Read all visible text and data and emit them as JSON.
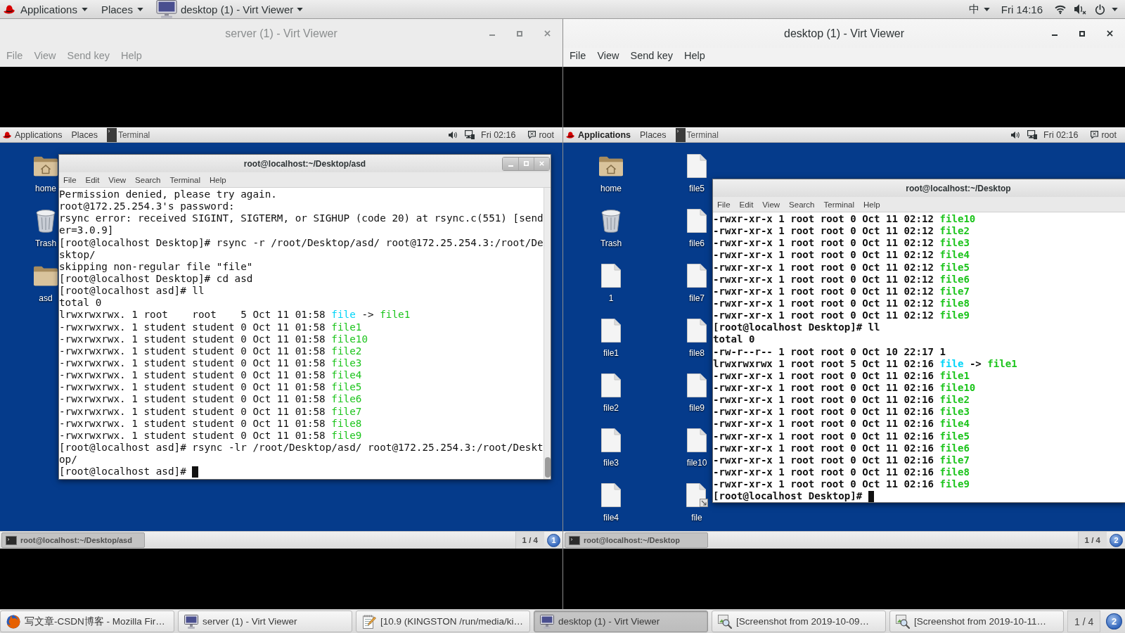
{
  "top_bar": {
    "menus": [
      {
        "label": "Applications"
      },
      {
        "label": "Places"
      }
    ],
    "window_menu": "desktop (1) - Virt Viewer",
    "input_method": "中",
    "clock": "Fri 14:16"
  },
  "windows": [
    {
      "title": "server (1) - Virt Viewer",
      "focused": false,
      "menu": [
        {
          "label": "File"
        },
        {
          "label": "View"
        },
        {
          "label": "Send key"
        },
        {
          "label": "Help"
        }
      ],
      "guest": {
        "top_bar": {
          "menus": [
            {
              "label": "Applications",
              "highlighted": false
            },
            {
              "label": "Places",
              "highlighted": false
            }
          ],
          "app": "Terminal",
          "clock": "Fri 02:16",
          "user": "root"
        },
        "desktop_icons": [
          {
            "label": "home",
            "kind": "home"
          },
          {
            "label": "Trash",
            "kind": "trash"
          },
          {
            "label": "asd",
            "kind": "folder"
          }
        ],
        "terminal": {
          "title": "root@localhost:~/Desktop/asd",
          "window_buttons": true,
          "scrollbar": true,
          "cursor": true,
          "menu": [
            {
              "label": "File"
            },
            {
              "label": "Edit"
            },
            {
              "label": "View"
            },
            {
              "label": "Search"
            },
            {
              "label": "Terminal"
            },
            {
              "label": "Help"
            }
          ],
          "lines": [
            {
              "parts": [
                {
                  "text": "Permission denied, please try again.",
                  "kind": "plain"
                }
              ]
            },
            {
              "parts": [
                {
                  "text": "root@172.25.254.3's password:",
                  "kind": "plain"
                }
              ]
            },
            {
              "parts": [
                {
                  "text": "rsync error: received SIGINT, SIGTERM, or SIGHUP (code 20) at rsync.c(551) [send",
                  "kind": "plain"
                }
              ]
            },
            {
              "parts": [
                {
                  "text": "er=3.0.9]",
                  "kind": "plain"
                }
              ]
            },
            {
              "parts": [
                {
                  "text": "[root@localhost Desktop]# rsync -r /root/Desktop/asd/ root@172.25.254.3:/root/De",
                  "kind": "plain"
                }
              ]
            },
            {
              "parts": [
                {
                  "text": "sktop/",
                  "kind": "plain"
                }
              ]
            },
            {
              "parts": [
                {
                  "text": "skipping non-regular file \"file\"",
                  "kind": "plain"
                }
              ]
            },
            {
              "parts": [
                {
                  "text": "[root@localhost Desktop]# cd asd",
                  "kind": "plain"
                }
              ]
            },
            {
              "parts": [
                {
                  "text": "[root@localhost asd]# ll",
                  "kind": "plain"
                }
              ]
            },
            {
              "parts": [
                {
                  "text": "total 0",
                  "kind": "plain"
                }
              ]
            },
            {
              "parts": [
                {
                  "text": "lrwxrwxrwx. 1 root    root    5 Oct 11 01:58 ",
                  "kind": "plain"
                },
                {
                  "text": "file",
                  "kind": "link"
                },
                {
                  "text": " -> ",
                  "kind": "plain"
                },
                {
                  "text": "file1",
                  "kind": "exec"
                }
              ]
            },
            {
              "parts": [
                {
                  "text": "-rwxrwxrwx. 1 student student 0 Oct 11 01:58 ",
                  "kind": "plain"
                },
                {
                  "text": "file1",
                  "kind": "exec"
                }
              ]
            },
            {
              "parts": [
                {
                  "text": "-rwxrwxrwx. 1 student student 0 Oct 11 01:58 ",
                  "kind": "plain"
                },
                {
                  "text": "file10",
                  "kind": "exec"
                }
              ]
            },
            {
              "parts": [
                {
                  "text": "-rwxrwxrwx. 1 student student 0 Oct 11 01:58 ",
                  "kind": "plain"
                },
                {
                  "text": "file2",
                  "kind": "exec"
                }
              ]
            },
            {
              "parts": [
                {
                  "text": "-rwxrwxrwx. 1 student student 0 Oct 11 01:58 ",
                  "kind": "plain"
                },
                {
                  "text": "file3",
                  "kind": "exec"
                }
              ]
            },
            {
              "parts": [
                {
                  "text": "-rwxrwxrwx. 1 student student 0 Oct 11 01:58 ",
                  "kind": "plain"
                },
                {
                  "text": "file4",
                  "kind": "exec"
                }
              ]
            },
            {
              "parts": [
                {
                  "text": "-rwxrwxrwx. 1 student student 0 Oct 11 01:58 ",
                  "kind": "plain"
                },
                {
                  "text": "file5",
                  "kind": "exec"
                }
              ]
            },
            {
              "parts": [
                {
                  "text": "-rwxrwxrwx. 1 student student 0 Oct 11 01:58 ",
                  "kind": "plain"
                },
                {
                  "text": "file6",
                  "kind": "exec"
                }
              ]
            },
            {
              "parts": [
                {
                  "text": "-rwxrwxrwx. 1 student student 0 Oct 11 01:58 ",
                  "kind": "plain"
                },
                {
                  "text": "file7",
                  "kind": "exec"
                }
              ]
            },
            {
              "parts": [
                {
                  "text": "-rwxrwxrwx. 1 student student 0 Oct 11 01:58 ",
                  "kind": "plain"
                },
                {
                  "text": "file8",
                  "kind": "exec"
                }
              ]
            },
            {
              "parts": [
                {
                  "text": "-rwxrwxrwx. 1 student student 0 Oct 11 01:58 ",
                  "kind": "plain"
                },
                {
                  "text": "file9",
                  "kind": "exec"
                }
              ]
            },
            {
              "parts": [
                {
                  "text": "[root@localhost asd]# rsync -lr /root/Desktop/asd/ root@172.25.254.3:/root/Deskt",
                  "kind": "plain"
                }
              ]
            },
            {
              "parts": [
                {
                  "text": "op/",
                  "kind": "plain"
                }
              ]
            },
            {
              "parts": [
                {
                  "text": "[root@localhost asd]#",
                  "kind": "plain"
                }
              ]
            }
          ]
        },
        "bottom_panel": {
          "window_button": "root@localhost:~/Desktop/asd",
          "workspace": "1 / 4",
          "badge": "1"
        }
      }
    },
    {
      "title": "desktop (1) - Virt Viewer",
      "focused": true,
      "menu": [
        {
          "label": "File"
        },
        {
          "label": "View"
        },
        {
          "label": "Send key"
        },
        {
          "label": "Help"
        }
      ],
      "guest": {
        "top_bar": {
          "menus": [
            {
              "label": "Applications",
              "highlighted": true
            },
            {
              "label": "Places",
              "highlighted": false
            }
          ],
          "app": "Terminal",
          "clock": "Fri 02:16",
          "user": "root"
        },
        "desktop_icons": [
          {
            "label": "home",
            "kind": "home"
          },
          {
            "label": "Trash",
            "kind": "trash"
          },
          {
            "label": "1",
            "kind": "file"
          },
          {
            "label": "file1",
            "kind": "file"
          },
          {
            "label": "file2",
            "kind": "file"
          },
          {
            "label": "file3",
            "kind": "file"
          },
          {
            "label": "file4",
            "kind": "file"
          },
          {
            "label": "file5",
            "kind": "file"
          },
          {
            "label": "file6",
            "kind": "file"
          },
          {
            "label": "file7",
            "kind": "file"
          },
          {
            "label": "file8",
            "kind": "file"
          },
          {
            "label": "file9",
            "kind": "file"
          },
          {
            "label": "file10",
            "kind": "file"
          },
          {
            "label": "file",
            "kind": "link"
          }
        ],
        "terminal": {
          "title": "root@localhost:~/Desktop",
          "cursor": true,
          "menu": [
            {
              "label": "File"
            },
            {
              "label": "Edit"
            },
            {
              "label": "View"
            },
            {
              "label": "Search"
            },
            {
              "label": "Terminal"
            },
            {
              "label": "Help"
            }
          ],
          "lines": [
            {
              "parts": [
                {
                  "text": "-rwxr-xr-x 1 root root 0 Oct 11 02:12 ",
                  "kind": "plain"
                },
                {
                  "text": "file10",
                  "kind": "exec"
                }
              ]
            },
            {
              "parts": [
                {
                  "text": "-rwxr-xr-x 1 root root 0 Oct 11 02:12 ",
                  "kind": "plain"
                },
                {
                  "text": "file2",
                  "kind": "exec"
                }
              ]
            },
            {
              "parts": [
                {
                  "text": "-rwxr-xr-x 1 root root 0 Oct 11 02:12 ",
                  "kind": "plain"
                },
                {
                  "text": "file3",
                  "kind": "exec"
                }
              ]
            },
            {
              "parts": [
                {
                  "text": "-rwxr-xr-x 1 root root 0 Oct 11 02:12 ",
                  "kind": "plain"
                },
                {
                  "text": "file4",
                  "kind": "exec"
                }
              ]
            },
            {
              "parts": [
                {
                  "text": "-rwxr-xr-x 1 root root 0 Oct 11 02:12 ",
                  "kind": "plain"
                },
                {
                  "text": "file5",
                  "kind": "exec"
                }
              ]
            },
            {
              "parts": [
                {
                  "text": "-rwxr-xr-x 1 root root 0 Oct 11 02:12 ",
                  "kind": "plain"
                },
                {
                  "text": "file6",
                  "kind": "exec"
                }
              ]
            },
            {
              "parts": [
                {
                  "text": "-rwxr-xr-x 1 root root 0 Oct 11 02:12 ",
                  "kind": "plain"
                },
                {
                  "text": "file7",
                  "kind": "exec"
                }
              ]
            },
            {
              "parts": [
                {
                  "text": "-rwxr-xr-x 1 root root 0 Oct 11 02:12 ",
                  "kind": "plain"
                },
                {
                  "text": "file8",
                  "kind": "exec"
                }
              ]
            },
            {
              "parts": [
                {
                  "text": "-rwxr-xr-x 1 root root 0 Oct 11 02:12 ",
                  "kind": "plain"
                },
                {
                  "text": "file9",
                  "kind": "exec"
                }
              ]
            },
            {
              "parts": [
                {
                  "text": "[root@localhost Desktop]# ll",
                  "kind": "plain"
                }
              ]
            },
            {
              "parts": [
                {
                  "text": "total 0",
                  "kind": "plain"
                }
              ]
            },
            {
              "parts": [
                {
                  "text": "-rw-r--r-- 1 root root 0 Oct 10 22:17 1",
                  "kind": "plain"
                }
              ]
            },
            {
              "parts": [
                {
                  "text": "lrwxrwxrwx 1 root root 5 Oct 11 02:16 ",
                  "kind": "plain"
                },
                {
                  "text": "file",
                  "kind": "link"
                },
                {
                  "text": " -> ",
                  "kind": "plain"
                },
                {
                  "text": "file1",
                  "kind": "exec"
                }
              ]
            },
            {
              "parts": [
                {
                  "text": "-rwxr-xr-x 1 root root 0 Oct 11 02:16 ",
                  "kind": "plain"
                },
                {
                  "text": "file1",
                  "kind": "exec"
                }
              ]
            },
            {
              "parts": [
                {
                  "text": "-rwxr-xr-x 1 root root 0 Oct 11 02:16 ",
                  "kind": "plain"
                },
                {
                  "text": "file10",
                  "kind": "exec"
                }
              ]
            },
            {
              "parts": [
                {
                  "text": "-rwxr-xr-x 1 root root 0 Oct 11 02:16 ",
                  "kind": "plain"
                },
                {
                  "text": "file2",
                  "kind": "exec"
                }
              ]
            },
            {
              "parts": [
                {
                  "text": "-rwxr-xr-x 1 root root 0 Oct 11 02:16 ",
                  "kind": "plain"
                },
                {
                  "text": "file3",
                  "kind": "exec"
                }
              ]
            },
            {
              "parts": [
                {
                  "text": "-rwxr-xr-x 1 root root 0 Oct 11 02:16 ",
                  "kind": "plain"
                },
                {
                  "text": "file4",
                  "kind": "exec"
                }
              ]
            },
            {
              "parts": [
                {
                  "text": "-rwxr-xr-x 1 root root 0 Oct 11 02:16 ",
                  "kind": "plain"
                },
                {
                  "text": "file5",
                  "kind": "exec"
                }
              ]
            },
            {
              "parts": [
                {
                  "text": "-rwxr-xr-x 1 root root 0 Oct 11 02:16 ",
                  "kind": "plain"
                },
                {
                  "text": "file6",
                  "kind": "exec"
                }
              ]
            },
            {
              "parts": [
                {
                  "text": "-rwxr-xr-x 1 root root 0 Oct 11 02:16 ",
                  "kind": "plain"
                },
                {
                  "text": "file7",
                  "kind": "exec"
                }
              ]
            },
            {
              "parts": [
                {
                  "text": "-rwxr-xr-x 1 root root 0 Oct 11 02:16 ",
                  "kind": "plain"
                },
                {
                  "text": "file8",
                  "kind": "exec"
                }
              ]
            },
            {
              "parts": [
                {
                  "text": "-rwxr-xr-x 1 root root 0 Oct 11 02:16 ",
                  "kind": "plain"
                },
                {
                  "text": "file9",
                  "kind": "exec"
                }
              ]
            },
            {
              "parts": [
                {
                  "text": "[root@localhost Desktop]#",
                  "kind": "plain"
                }
              ]
            }
          ]
        },
        "bottom_panel": {
          "window_button": "root@localhost:~/Desktop",
          "workspace": "1 / 4",
          "badge": "2"
        }
      }
    }
  ],
  "taskbar": {
    "items": [
      {
        "label": "写文章-CSDN博客 - Mozilla Fir…",
        "kind": "browser",
        "selected": false
      },
      {
        "label": "server (1) - Virt Viewer",
        "kind": "viewer",
        "selected": false
      },
      {
        "label": "[10.9 (KINGSTON /run/media/ki…",
        "kind": "editor",
        "selected": false
      },
      {
        "label": "desktop (1) - Virt Viewer",
        "kind": "viewer",
        "selected": true
      },
      {
        "label": "[Screenshot from 2019-10-09…",
        "kind": "image",
        "selected": false
      },
      {
        "label": "[Screenshot from 2019-10-11…",
        "kind": "image",
        "selected": false
      }
    ],
    "workspace": "1 / 4",
    "badge": "2"
  }
}
